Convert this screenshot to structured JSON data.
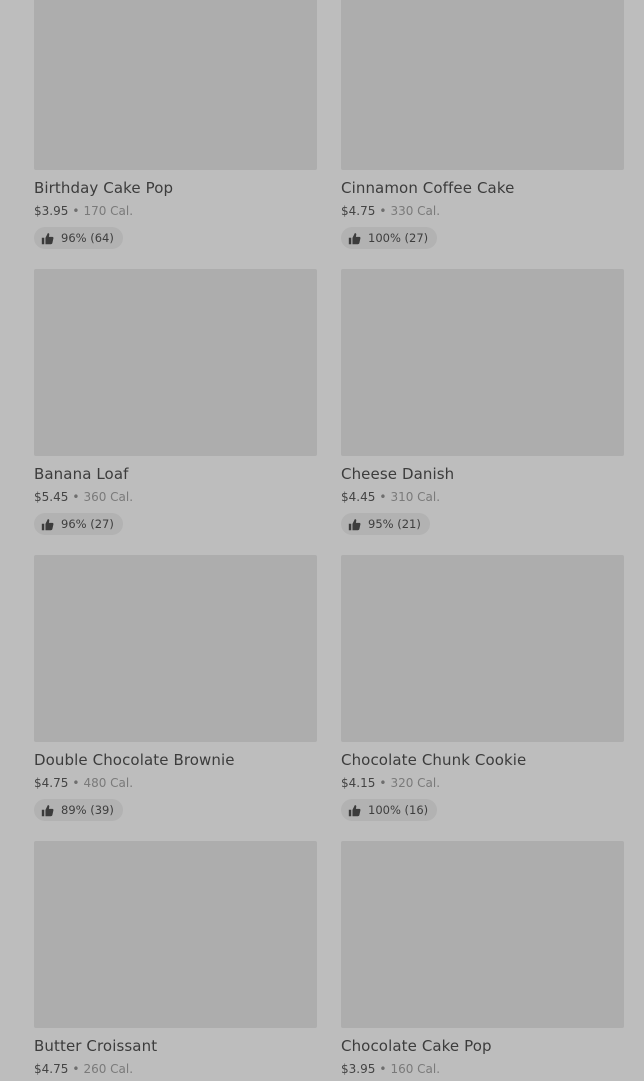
{
  "items": [
    {
      "name": "Birthday Cake Pop",
      "price": "$3.95",
      "calories": "170 Cal.",
      "rating": "96% (64)"
    },
    {
      "name": "Cinnamon Coffee Cake",
      "price": "$4.75",
      "calories": "330 Cal.",
      "rating": "100% (27)"
    },
    {
      "name": "Banana Loaf",
      "price": "$5.45",
      "calories": "360 Cal.",
      "rating": "96% (27)"
    },
    {
      "name": "Cheese Danish",
      "price": "$4.45",
      "calories": "310 Cal.",
      "rating": "95% (21)"
    },
    {
      "name": "Double Chocolate Brownie",
      "price": "$4.75",
      "calories": "480 Cal.",
      "rating": "89% (39)"
    },
    {
      "name": "Chocolate Chunk Cookie",
      "price": "$4.15",
      "calories": "320 Cal.",
      "rating": "100% (16)"
    },
    {
      "name": "Butter Croissant",
      "price": "$4.75",
      "calories": "260 Cal.",
      "rating": ""
    },
    {
      "name": "Chocolate Cake Pop",
      "price": "$3.95",
      "calories": "160 Cal.",
      "rating": ""
    }
  ],
  "separator": "•",
  "rating_icon": "thumbs-up-icon"
}
